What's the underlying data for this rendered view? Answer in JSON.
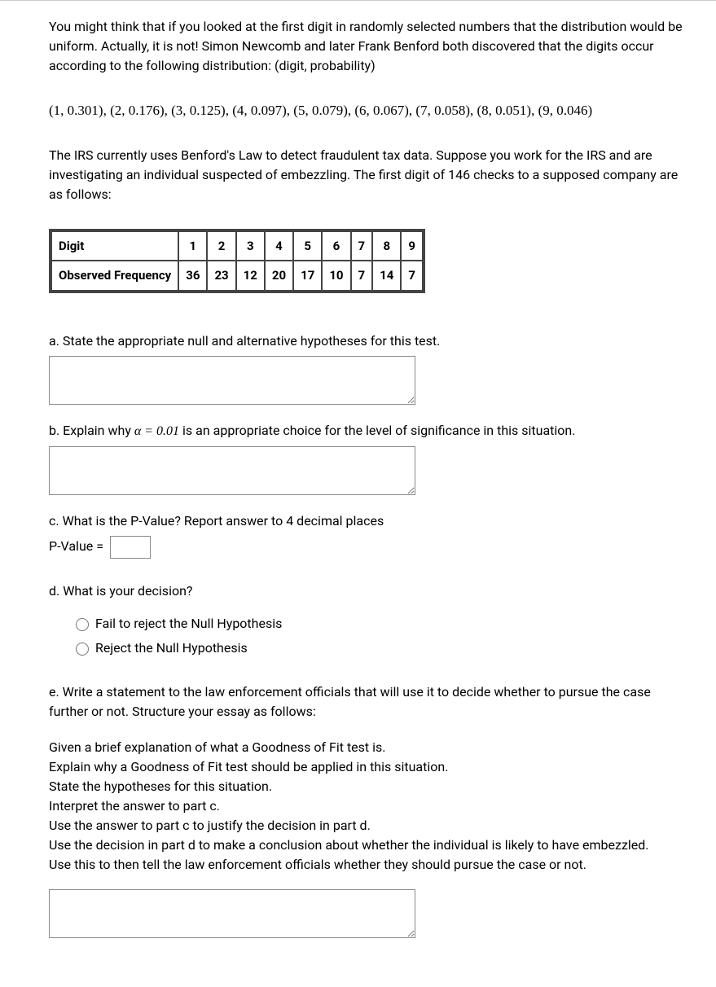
{
  "intro": "You might think that if you looked at the first digit in randomly selected numbers that the distribution would be uniform. Actually, it is not! Simon Newcomb and later Frank Benford both discovered that the digits occur according to the following distribution: (digit, probability)",
  "distribution": "(1, 0.301), (2, 0.176), (3, 0.125), (4, 0.097), (5, 0.079), (6, 0.067), (7, 0.058), (8, 0.051), (9, 0.046)",
  "scenario": "The IRS currently uses Benford's Law to detect fraudulent tax data. Suppose you work for the IRS and are investigating an individual suspected of embezzling. The first digit of 146 checks to a supposed company are as follows:",
  "table": {
    "row1_label": "Digit",
    "row1": [
      "1",
      "2",
      "3",
      "4",
      "5",
      "6",
      "7",
      "8",
      "9"
    ],
    "row2_label": "Observed Frequency",
    "row2": [
      "36",
      "23",
      "12",
      "20",
      "17",
      "10",
      "7",
      "14",
      "7"
    ]
  },
  "qa": {
    "label": "a. State the appropriate null and alternative hypotheses for this test."
  },
  "qb": {
    "prefix": "b. Explain why ",
    "alpha": "α = 0.01",
    "suffix": " is an appropriate choice for the level of significance in this situation."
  },
  "qc": {
    "label": "c. What is the P-Value? Report answer to 4 decimal places",
    "pvalue_label": "P-Value ="
  },
  "qd": {
    "label": "d. What is your decision?",
    "opt1": "Fail to reject the Null Hypothesis",
    "opt2": "Reject the Null Hypothesis"
  },
  "qe": {
    "lead": "e. Write a statement to the law enforcement officials that will use it to decide whether to pursue the case further or not. Structure your essay as follows:",
    "line1": "Given a brief explanation of what a Goodness of Fit test is.",
    "line2": "Explain why a Goodness of Fit test should be applied in this situation.",
    "line3": "State the hypotheses for this situation.",
    "line4": "Interpret the answer to part c.",
    "line5": "Use the answer to part c to justify the decision in part d.",
    "line6": "Use the decision in part d to make a conclusion about whether the individual is likely to have embezzled.",
    "line7": "Use this to then tell the law enforcement officials whether they should pursue the case or not."
  }
}
